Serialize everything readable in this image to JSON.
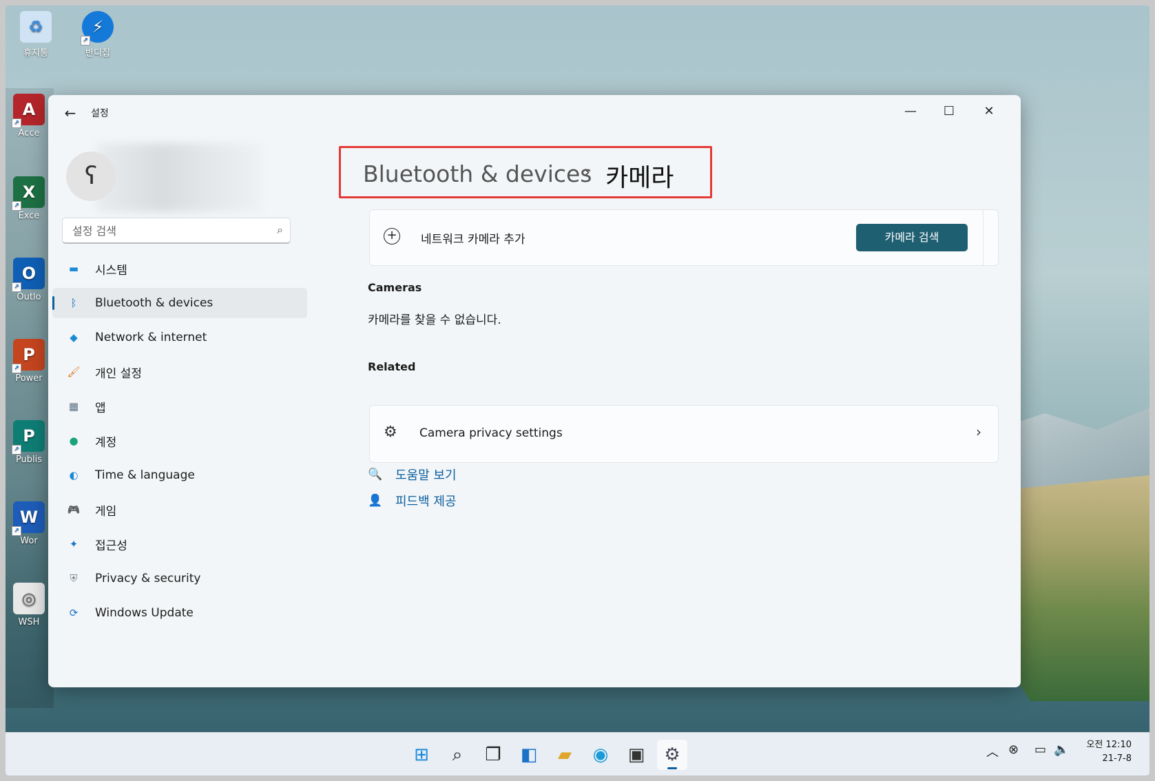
{
  "desktop": {
    "icons": [
      {
        "label": "휴지통",
        "glyph": "♻",
        "color": "#3a8de0"
      },
      {
        "label": "반디집",
        "glyph": "⚡",
        "color": "#1479d8"
      },
      {
        "label": "Acce",
        "glyph": "A",
        "color": "#b4262b"
      },
      {
        "label": "Exce",
        "glyph": "X",
        "color": "#1d7044"
      },
      {
        "label": "Outlo",
        "glyph": "O",
        "color": "#0f5fb5"
      },
      {
        "label": "Power",
        "glyph": "P",
        "color": "#c5451f"
      },
      {
        "label": "Publis",
        "glyph": "P",
        "color": "#0e7e75"
      },
      {
        "label": "Wor",
        "glyph": "W",
        "color": "#1d5cb8"
      },
      {
        "label": "WSH",
        "glyph": "◎",
        "color": "#d9d9d9"
      }
    ]
  },
  "window": {
    "title": "설정",
    "controls": {
      "minimize": "—",
      "maximize": "☐",
      "close": "✕"
    }
  },
  "profile": {
    "avatar_glyph": "ʕ"
  },
  "search": {
    "placeholder": "설정 검색"
  },
  "sidebar": {
    "items": [
      {
        "label": "시스템",
        "icon": "system-icon",
        "glyph": "▬",
        "color": "#1a8ad8"
      },
      {
        "label": "Bluetooth & devices",
        "icon": "bluetooth-icon",
        "glyph": "ᛒ",
        "color": "#1a73c8"
      },
      {
        "label": "Network & internet",
        "icon": "wifi-icon",
        "glyph": "◆",
        "color": "#1a8ad8"
      },
      {
        "label": "개인 설정",
        "icon": "brush-icon",
        "glyph": "🖌",
        "color": "#d47a2a"
      },
      {
        "label": "앱",
        "icon": "apps-icon",
        "glyph": "▦",
        "color": "#5c6f84"
      },
      {
        "label": "계정",
        "icon": "account-icon",
        "glyph": "●",
        "color": "#1aa37a"
      },
      {
        "label": "Time & language",
        "icon": "globe-icon",
        "glyph": "◐",
        "color": "#1a8ad8"
      },
      {
        "label": "게임",
        "icon": "gamepad-icon",
        "glyph": "🎮",
        "color": "#6b7785"
      },
      {
        "label": "접근성",
        "icon": "accessibility-icon",
        "glyph": "✦",
        "color": "#1a73c8"
      },
      {
        "label": "Privacy & security",
        "icon": "shield-icon",
        "glyph": "⛨",
        "color": "#7b8794"
      },
      {
        "label": "Windows Update",
        "icon": "update-icon",
        "glyph": "⟳",
        "color": "#1a73c8"
      }
    ],
    "active_index": 1
  },
  "breadcrumb": {
    "parent": "Bluetooth & devices",
    "separator": "›",
    "current": "카메라"
  },
  "add_camera": {
    "label": "네트워크 카메라 추가",
    "button": "카메라 검색"
  },
  "cameras": {
    "heading": "Cameras",
    "empty_text": "카메라를 찾을 수 없습니다."
  },
  "related": {
    "heading": "Related",
    "item": "Camera privacy settings"
  },
  "links": {
    "help": "도움말 보기",
    "feedback": "피드백 제공"
  },
  "taskbar": {
    "clock": {
      "time": "오전 12:10",
      "date": "21-7-8"
    }
  }
}
